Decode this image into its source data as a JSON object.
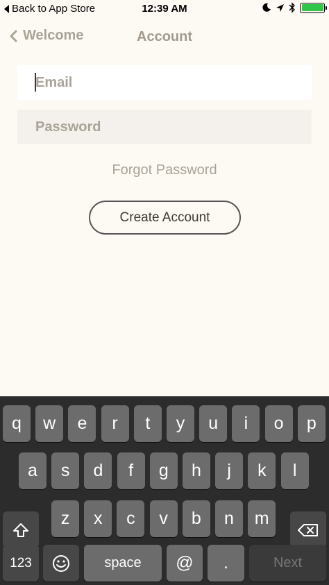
{
  "status_bar": {
    "back_label": "Back to App Store",
    "time": "12:39 AM"
  },
  "nav": {
    "back_label": "Welcome",
    "title": "Account"
  },
  "form": {
    "email_placeholder": "Email",
    "password_placeholder": "Password",
    "forgot_label": "Forgot Password",
    "create_label": "Create Account"
  },
  "keyboard": {
    "row1": [
      "q",
      "w",
      "e",
      "r",
      "t",
      "y",
      "u",
      "i",
      "o",
      "p"
    ],
    "row2": [
      "a",
      "s",
      "d",
      "f",
      "g",
      "h",
      "j",
      "k",
      "l"
    ],
    "row3": [
      "z",
      "x",
      "c",
      "v",
      "b",
      "n",
      "m"
    ],
    "numbers_label": "123",
    "space_label": "space",
    "at_label": "@",
    "dot_label": ".",
    "next_label": "Next"
  },
  "colors": {
    "battery": "#2fc64a",
    "background": "#fdfaf3",
    "keyboard": "#2c2c2c"
  }
}
